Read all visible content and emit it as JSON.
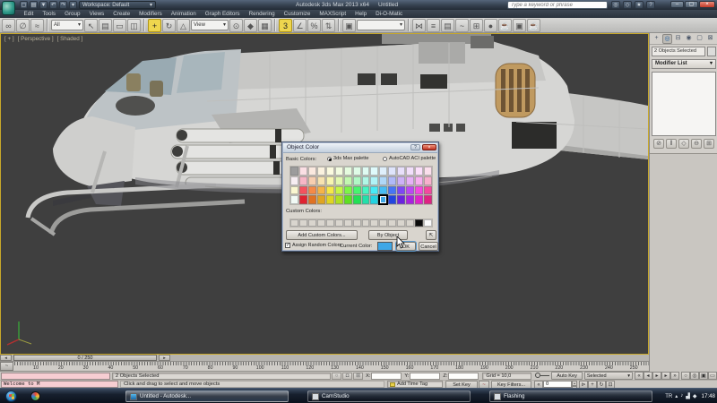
{
  "titlebar": {
    "product_title": "Autodesk 3ds Max 2013 x64",
    "doc_title": "Untitled",
    "workspace": "Workspace: Default",
    "search_placeholder": "Type a keyword or phrase",
    "quick_access": [
      {
        "name": "new-file-icon",
        "glyph": "▢"
      },
      {
        "name": "open-file-icon",
        "glyph": "▤"
      },
      {
        "name": "save-file-icon",
        "glyph": "▼"
      },
      {
        "name": "undo-icon",
        "glyph": "↶"
      },
      {
        "name": "redo-icon",
        "glyph": "↷"
      },
      {
        "name": "workspace-menu-icon",
        "glyph": "▾"
      }
    ],
    "right_icons": [
      {
        "name": "search-go-icon",
        "glyph": "◎"
      },
      {
        "name": "communication-center-icon",
        "glyph": "◇"
      },
      {
        "name": "favorites-icon",
        "glyph": "★"
      },
      {
        "name": "help-icon",
        "glyph": "?"
      }
    ],
    "window_buttons": [
      {
        "name": "minimize-button",
        "glyph": "–"
      },
      {
        "name": "maximize-button",
        "glyph": "▢"
      },
      {
        "name": "close-button",
        "glyph": "×"
      }
    ]
  },
  "menubar": {
    "items": [
      "Edit",
      "Tools",
      "Group",
      "Views",
      "Create",
      "Modifiers",
      "Animation",
      "Graph Editors",
      "Rendering",
      "Customize",
      "MAXScript",
      "Help",
      "Di-O-Matic"
    ]
  },
  "toolbar": {
    "items": [
      {
        "t": "icon",
        "name": "select-and-link-icon",
        "glyph": "∞"
      },
      {
        "t": "icon",
        "name": "unlink-selection-icon",
        "glyph": "∅"
      },
      {
        "t": "icon",
        "name": "bind-to-spacewarp-icon",
        "glyph": "≈"
      },
      {
        "t": "sep"
      },
      {
        "t": "dd",
        "name": "selection-filter-dropdown",
        "label": "All"
      },
      {
        "t": "icon",
        "name": "select-object-icon",
        "glyph": "↖"
      },
      {
        "t": "icon",
        "name": "select-by-name-icon",
        "glyph": "▤"
      },
      {
        "t": "icon",
        "name": "selection-region-icon",
        "glyph": "▭"
      },
      {
        "t": "icon",
        "name": "window-crossing-icon",
        "glyph": "◫"
      },
      {
        "t": "sep"
      },
      {
        "t": "icon",
        "name": "select-and-move-icon",
        "glyph": "+",
        "hl": true
      },
      {
        "t": "icon",
        "name": "select-and-rotate-icon",
        "glyph": "↻"
      },
      {
        "t": "icon",
        "name": "select-and-scale-icon",
        "glyph": "△"
      },
      {
        "t": "dd",
        "name": "reference-coordinate-dropdown",
        "label": "View"
      },
      {
        "t": "icon",
        "name": "use-pivot-center-icon",
        "glyph": "⊙"
      },
      {
        "t": "icon",
        "name": "select-and-manipulate-icon",
        "glyph": "◆"
      },
      {
        "t": "icon",
        "name": "keyboard-override-icon",
        "glyph": "▦"
      },
      {
        "t": "sep"
      },
      {
        "t": "icon",
        "name": "snap-toggle-3d-icon",
        "glyph": "3",
        "hl": true
      },
      {
        "t": "icon",
        "name": "angle-snap-icon",
        "glyph": "∠"
      },
      {
        "t": "icon",
        "name": "percent-snap-icon",
        "glyph": "%"
      },
      {
        "t": "icon",
        "name": "spinner-snap-icon",
        "glyph": "⇅"
      },
      {
        "t": "sep"
      },
      {
        "t": "icon",
        "name": "edit-named-selections-icon",
        "glyph": "▣"
      },
      {
        "t": "dd",
        "name": "named-selection-dropdown",
        "label": ""
      },
      {
        "t": "sep"
      },
      {
        "t": "icon",
        "name": "mirror-icon",
        "glyph": "⋈"
      },
      {
        "t": "icon",
        "name": "align-icon",
        "glyph": "≡"
      },
      {
        "t": "icon",
        "name": "layer-manager-icon",
        "glyph": "▤"
      },
      {
        "t": "icon",
        "name": "curve-editor-icon",
        "glyph": "~"
      },
      {
        "t": "icon",
        "name": "schematic-view-icon",
        "glyph": "⊞"
      },
      {
        "t": "icon",
        "name": "material-editor-icon",
        "glyph": "●"
      },
      {
        "t": "icon",
        "name": "render-setup-icon",
        "glyph": "☕"
      },
      {
        "t": "icon",
        "name": "rendered-frame-icon",
        "glyph": "▣"
      },
      {
        "t": "icon",
        "name": "render-production-icon",
        "glyph": "☕"
      }
    ]
  },
  "viewport": {
    "label_general": "[ + ]",
    "label_pov": "[ Perspective ]",
    "label_shading": "[ Shaded ]"
  },
  "object_color_dialog": {
    "title": "Object Color",
    "basic_colors_label": "Basic Colors:",
    "radio_max_label": "3ds Max palette",
    "radio_acad_label": "AutoCAD ACI palette",
    "custom_colors_label": "Custom Colors:",
    "add_custom_button": "Add Custom Colors...",
    "by_object_button": "By Object",
    "assign_random_label": "Assign Random Colors",
    "current_color_label": "Current Color:",
    "current_color": "#3fa7e6",
    "ok_button": "OK",
    "cancel_button": "Cancel",
    "close_glyph": "×",
    "help_glyph": "?",
    "selected_cell": {
      "row": 3,
      "col": 10
    },
    "palette": [
      [
        "#9c9c9c",
        "#fbdfe4",
        "#fbe9df",
        "#fbf2df",
        "#fbfadf",
        "#f2fbdf",
        "#e5fbdf",
        "#dffbe7",
        "#dffbf2",
        "#dffafb",
        "#dfeffb",
        "#dfe4fb",
        "#e8dffb",
        "#f2dffb",
        "#fbdffa",
        "#fbdfec"
      ],
      [
        "#f7eef2",
        "#f7b6c6",
        "#f7ceb0",
        "#f7e3b0",
        "#f7f5b0",
        "#e2f7b0",
        "#c2f7b0",
        "#b0f7c5",
        "#b0f7e6",
        "#b0f3f7",
        "#b0d7f7",
        "#b0b9f7",
        "#cdb0f7",
        "#e7b0f7",
        "#f7b0ef",
        "#f7b0cd"
      ],
      [
        "#faf7d0",
        "#f5525e",
        "#f58a47",
        "#f5b447",
        "#f5e847",
        "#c6f547",
        "#7df547",
        "#47f56e",
        "#47f5c2",
        "#47eaf5",
        "#47bdf5",
        "#4775f5",
        "#7e47f5",
        "#bc47f5",
        "#f547e2",
        "#f547a0"
      ],
      [
        "#f2faf5",
        "#e02230",
        "#e07222",
        "#e0a422",
        "#e0d522",
        "#aee022",
        "#5ee022",
        "#22e055",
        "#22e0aa",
        "#22d2e0",
        "#3fa7e6",
        "#2245e0",
        "#6a22e0",
        "#a922e0",
        "#e022ca",
        "#e02283"
      ]
    ],
    "custom_colors": [
      "#d9d5ce",
      "#d9d5ce",
      "#d9d5ce",
      "#d9d5ce",
      "#d9d5ce",
      "#d9d5ce",
      "#d9d5ce",
      "#d9d5ce",
      "#d9d5ce",
      "#d9d5ce",
      "#d9d5ce",
      "#d9d5ce",
      "#d9d5ce",
      "#d9d5ce",
      "#0b0b0b",
      "#fbfbfb"
    ]
  },
  "command_panel": {
    "tabs": [
      {
        "name": "tab-create",
        "glyph": "+",
        "active": false
      },
      {
        "name": "tab-modify",
        "glyph": "◎",
        "active": true
      },
      {
        "name": "tab-hierarchy",
        "glyph": "⊟",
        "active": false
      },
      {
        "name": "tab-motion",
        "glyph": "◉",
        "active": false
      },
      {
        "name": "tab-display",
        "glyph": "▢",
        "active": false
      },
      {
        "name": "tab-utilities",
        "glyph": "⊠",
        "active": false
      }
    ],
    "selection_field": "2 Objects Selected",
    "modifier_list_label": "Modifier List",
    "stack_buttons": [
      {
        "name": "pin-stack-icon",
        "glyph": "⊘"
      },
      {
        "name": "show-end-result-icon",
        "glyph": "‖"
      },
      {
        "name": "make-unique-icon",
        "glyph": "◇"
      },
      {
        "name": "remove-modifier-icon",
        "glyph": "⊖"
      },
      {
        "name": "configure-modifier-sets-icon",
        "glyph": "⊞"
      }
    ]
  },
  "timeline": {
    "slider_label": "0 / 250",
    "left_arrow": "◂",
    "right_arrow": "▸",
    "tick_labels": [
      "10",
      "20",
      "30",
      "40",
      "50",
      "60",
      "70",
      "80",
      "90",
      "100",
      "110",
      "120",
      "130",
      "140",
      "150",
      "160",
      "170",
      "180",
      "190",
      "200",
      "210",
      "220",
      "230",
      "240",
      "250"
    ]
  },
  "statusbar": {
    "listener_line1": "",
    "listener_line2": "Welcome to M",
    "selection_status": "2 Objects Selected",
    "prompt": "Click and drag to select and move objects",
    "left_icons": [
      {
        "name": "isolate-toggle-icon",
        "glyph": "○"
      },
      {
        "name": "selection-lock-icon",
        "glyph": "◘"
      },
      {
        "name": "absolute-mode-icon",
        "glyph": "⊞"
      }
    ],
    "x_label": "X:",
    "y_label": "Y:",
    "z_label": "Z:",
    "grid": "Grid = 10,0",
    "auto_key": "Auto Key",
    "selected_filter": "Selected",
    "set_key": "Set Key",
    "key_filters": "Key Filters...",
    "add_time_tag": "Add Time Tag",
    "frame_value": "0",
    "playback": [
      {
        "name": "go-to-start-icon",
        "glyph": "«"
      },
      {
        "name": "previous-frame-icon",
        "glyph": "◂"
      },
      {
        "name": "play-animation-icon",
        "glyph": "▸"
      },
      {
        "name": "next-frame-icon",
        "glyph": "▸"
      },
      {
        "name": "go-to-end-icon",
        "glyph": "»"
      }
    ],
    "nav_icons": [
      {
        "name": "zoom-icon",
        "glyph": "○"
      },
      {
        "name": "zoom-all-icon",
        "glyph": "◎"
      },
      {
        "name": "zoom-extents-icon",
        "glyph": "▣"
      },
      {
        "name": "zoom-region-icon",
        "glyph": "▭"
      }
    ],
    "nav_icons2": [
      {
        "name": "key-mode-toggle-icon",
        "glyph": "⊳"
      },
      {
        "name": "pan-icon",
        "glyph": "+"
      },
      {
        "name": "orbit-icon",
        "glyph": "↻"
      },
      {
        "name": "maximize-viewport-toggle-icon",
        "glyph": "⊡"
      }
    ]
  },
  "taskbar": {
    "buttons": [
      {
        "name": "taskbar-button-3dsmax",
        "label": "Untitled - Autodesk...",
        "active": true
      },
      {
        "name": "taskbar-button-camstudio",
        "label": "CamStudio",
        "active": false
      },
      {
        "name": "taskbar-button-flashing",
        "label": "Flashing",
        "active": false
      }
    ],
    "language": "TR",
    "clock": "17:48",
    "tray_icons": [
      {
        "name": "show-hidden-icons",
        "glyph": "▴"
      },
      {
        "name": "volume-icon",
        "glyph": "♪"
      },
      {
        "name": "network-icon",
        "glyph": "▟"
      },
      {
        "name": "tray-app-icon",
        "glyph": "◆"
      }
    ]
  }
}
